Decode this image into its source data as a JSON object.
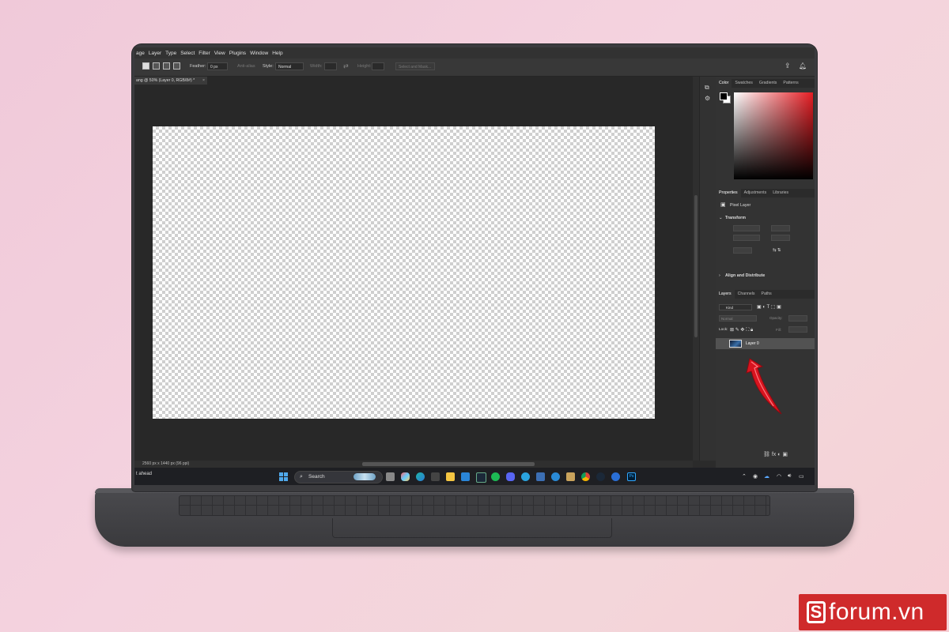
{
  "menu": [
    "age",
    "Layer",
    "Type",
    "Select",
    "Filter",
    "View",
    "Plugins",
    "Window",
    "Help"
  ],
  "options": {
    "feather_label": "Feather:",
    "feather_value": "0 px",
    "antialias_label": "Anti-alias",
    "style_label": "Style:",
    "style_value": "Normal",
    "width_label": "Width:",
    "height_label": "Height:",
    "select_mask_label": "Select and Mask..."
  },
  "document": {
    "tab_label": "ang @ 50% (Layer 0, RGB/8#) *",
    "tab_close": "×",
    "status_info": "2560 px x 1440 px (96 ppi)"
  },
  "color_panel": {
    "tabs": [
      "Color",
      "Swatches",
      "Gradients",
      "Patterns"
    ],
    "hue_color": "#e51d23"
  },
  "properties_panel": {
    "tabs": [
      "Properties",
      "Adjustments",
      "Libraries"
    ],
    "pixel_layer": "Pixel Layer",
    "transform": "Transform",
    "align": "Align and Distribute"
  },
  "layers_panel": {
    "tabs": [
      "Layers",
      "Channels",
      "Paths"
    ],
    "kind_label": "Kind",
    "blend_mode": "Normal",
    "opacity_label": "Opacity:",
    "lock_label": "Lock:",
    "fill_label": "Fill:",
    "layer_name": "Layer 0"
  },
  "taskbar": {
    "weather": "t ahead",
    "search": "Search"
  },
  "brand": {
    "letter": "S",
    "name": "forum.vn"
  }
}
